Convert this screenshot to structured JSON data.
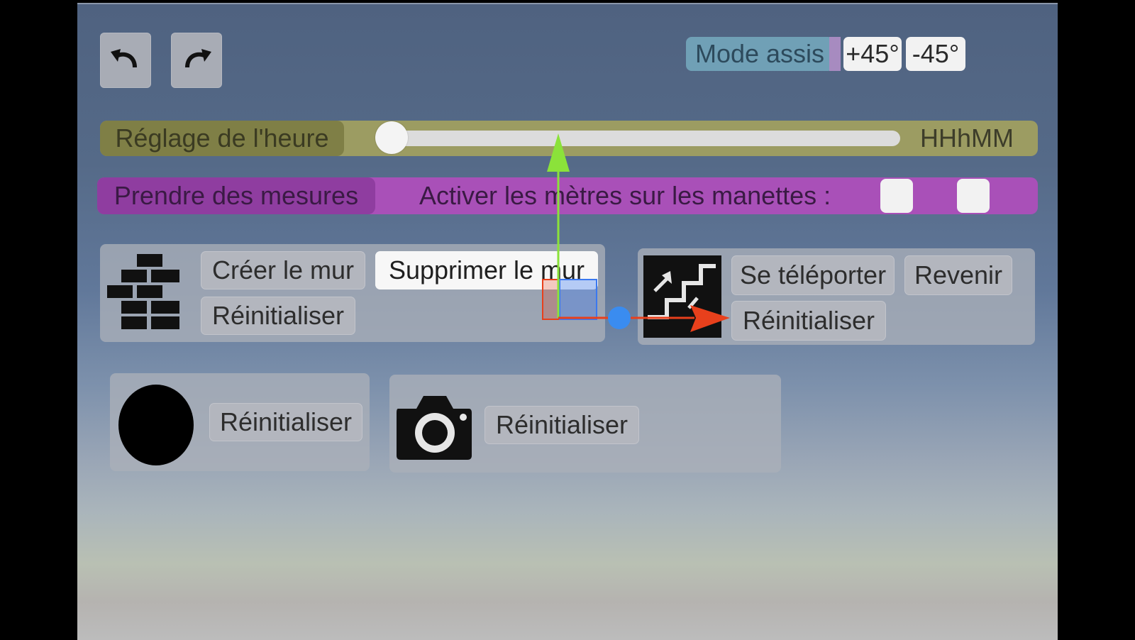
{
  "toolbar": {
    "undo": "undo-icon",
    "redo": "redo-icon"
  },
  "seated_mode": {
    "label": "Mode assis",
    "plus_label": "+45°",
    "minus_label": "-45°"
  },
  "time": {
    "label": "Réglage de l'heure",
    "value": "HHhMM",
    "slider_value": 0
  },
  "measure": {
    "label": "Prendre des mesures",
    "text": "Activer les mètres sur les manettes :"
  },
  "wall_panel": {
    "icon": "brick-wall-icon",
    "create_label": "Créer le mur",
    "delete_label": "Supprimer le mur",
    "reset_label": "Réinitialiser"
  },
  "teleport_panel": {
    "icon": "stairs-icon",
    "teleport_label": "Se téléporter",
    "back_label": "Revenir",
    "reset_label": "Réinitialiser"
  },
  "sun_panel": {
    "icon": "circle-icon",
    "reset_label": "Réinitialiser"
  },
  "camera_panel": {
    "icon": "camera-icon",
    "reset_label": "Réinitialiser"
  },
  "colors": {
    "time_bar": "#9c9c62",
    "measure_bar": "#a950b8",
    "mode_label": "#70a0b6",
    "gizmo_y": "#8be23a",
    "gizmo_x": "#e8401c",
    "gizmo_center": "#3a8cf0"
  }
}
